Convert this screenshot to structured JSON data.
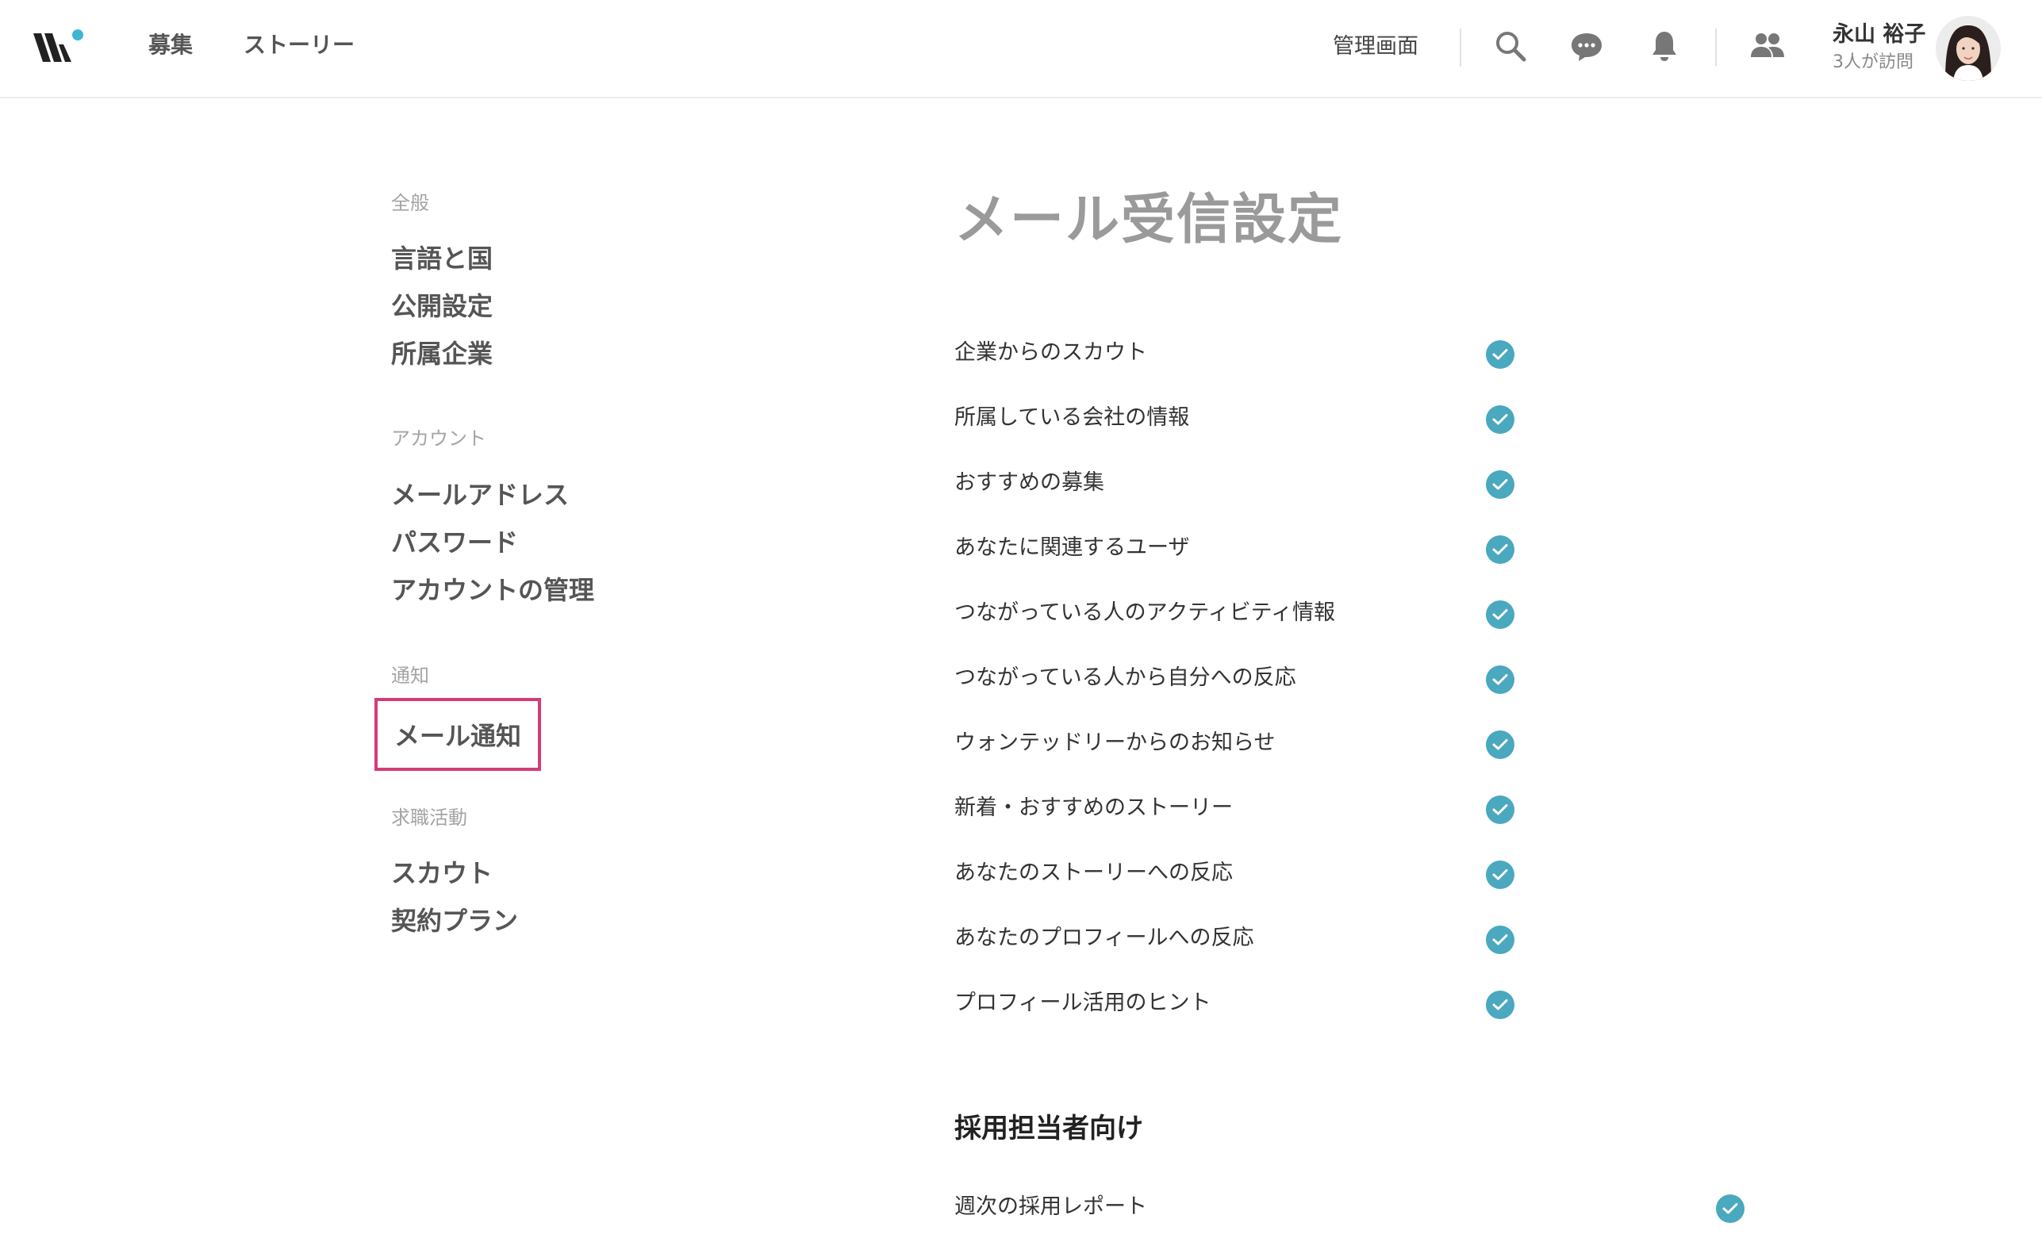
{
  "header": {
    "nav": [
      "募集",
      "ストーリー"
    ],
    "admin_label": "管理画面",
    "user_name": "永山 裕子",
    "user_visits": "3人が訪問",
    "icons": [
      "wantedly-logo",
      "search-icon",
      "chat-icon",
      "bell-icon",
      "people-icon"
    ],
    "logo_accent_color": "#3fb6cf"
  },
  "sidebar": {
    "sections": [
      {
        "title": "全般",
        "items": [
          "言語と国",
          "公開設定",
          "所属企業"
        ]
      },
      {
        "title": "アカウント",
        "items": [
          "メールアドレス",
          "パスワード",
          "アカウントの管理"
        ]
      },
      {
        "title": "通知",
        "items": [
          "メール通知"
        ]
      },
      {
        "title": "求職活動",
        "items": [
          "スカウト",
          "契約プラン"
        ]
      }
    ],
    "active_item": "メール通知",
    "highlight_color": "#d43c7b"
  },
  "main": {
    "title": "メール受信設定",
    "settings": [
      {
        "label": "企業からのスカウト",
        "checked": true
      },
      {
        "label": "所属している会社の情報",
        "checked": true
      },
      {
        "label": "おすすめの募集",
        "checked": true
      },
      {
        "label": "あなたに関連するユーザ",
        "checked": true
      },
      {
        "label": "つながっている人のアクティビティ情報",
        "checked": true
      },
      {
        "label": "つながっている人から自分への反応",
        "checked": true
      },
      {
        "label": "ウォンテッドリーからのお知らせ",
        "checked": true
      },
      {
        "label": "新着・おすすめのストーリー",
        "checked": true
      },
      {
        "label": "あなたのストーリーへの反応",
        "checked": true
      },
      {
        "label": "あなたのプロフィールへの反応",
        "checked": true
      },
      {
        "label": "プロフィール活用のヒント",
        "checked": true
      }
    ],
    "recruiter_section": {
      "title": "採用担当者向け",
      "settings": [
        {
          "label": "週次の採用レポート",
          "checked": true
        }
      ]
    },
    "check_color": "#4aa8bf"
  }
}
